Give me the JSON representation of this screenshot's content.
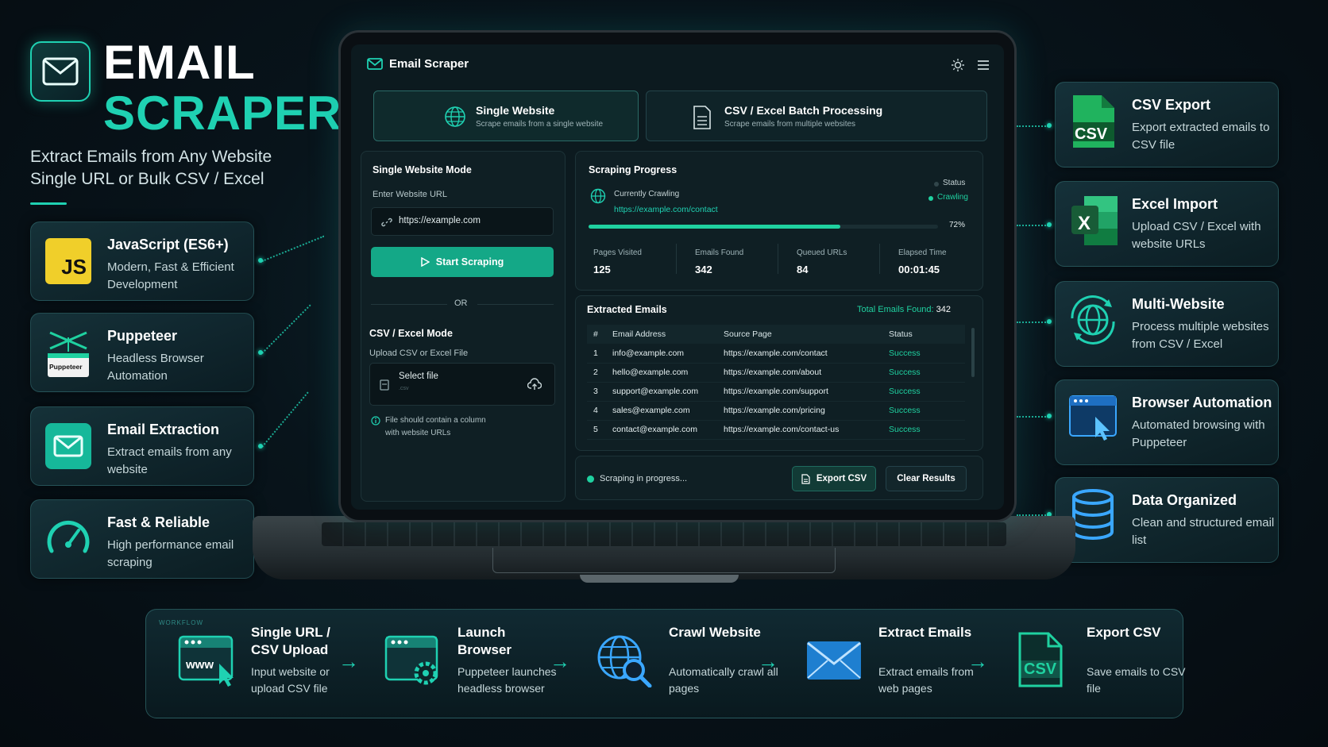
{
  "brand": {
    "title_line1": "EMAIL",
    "title_line2": "SCRAPER",
    "tagline_line1": "Extract Emails from Any Website",
    "tagline_line2": "Single URL or Bulk CSV / Excel",
    "accent_color": "#1fd1b2"
  },
  "left_features": [
    {
      "icon": "js-icon",
      "title": "JavaScript (ES6+)",
      "desc": "Modern, Fast & Efficient Development",
      "badge": "JS"
    },
    {
      "icon": "puppeteer-icon",
      "title": "Puppeteer",
      "desc": "Headless Browser Automation",
      "badge": "Puppeteer"
    },
    {
      "icon": "envelope-icon",
      "title": "Email Extraction",
      "desc": "Extract emails from any website"
    },
    {
      "icon": "speedometer-icon",
      "title": "Fast & Reliable",
      "desc": "High performance email scraping"
    }
  ],
  "right_features": [
    {
      "icon": "csv-file-icon",
      "title": "CSV Export",
      "desc": "Export extracted emails to CSV file",
      "badge": "CSV"
    },
    {
      "icon": "excel-icon",
      "title": "Excel Import",
      "desc": "Upload CSV / Excel with website URLs",
      "badge": "X"
    },
    {
      "icon": "globe-sync-icon",
      "title": "Multi-Website",
      "desc": "Process multiple websites from CSV / Excel"
    },
    {
      "icon": "browser-cursor-icon",
      "title": "Browser Automation",
      "desc": "Automated browsing with Puppeteer"
    },
    {
      "icon": "database-icon",
      "title": "Data Organized",
      "desc": "Clean and structured email list"
    }
  ],
  "app": {
    "title": "Email Scraper",
    "tabs": [
      {
        "title": "Single Website",
        "subtitle": "Scrape emails from a single website",
        "active": true
      },
      {
        "title": "CSV / Excel Batch Processing",
        "subtitle": "Scrape emails from multiple websites",
        "active": false
      }
    ],
    "single_mode": {
      "heading": "Single Website Mode",
      "url_label": "Enter Website URL",
      "url_value": "https://example.com",
      "start_button": "Start Scraping",
      "or_label": "OR"
    },
    "csv_mode": {
      "heading": "CSV / Excel Mode",
      "upload_label": "Upload CSV or Excel File",
      "select_file": "Select file",
      "file_hint": ".csv",
      "info_line1": "File should contain a column",
      "info_line2": "with website URLs"
    },
    "progress": {
      "heading": "Scraping Progress",
      "status_label": "Status",
      "status_value": "Crawling",
      "crawling_label": "Currently Crawling",
      "crawling_url": "https://example.com/contact",
      "percent": 72,
      "percent_label": "72%",
      "stats": [
        {
          "label": "Pages Visited",
          "value": "125"
        },
        {
          "label": "Emails Found",
          "value": "342"
        },
        {
          "label": "Queued URLs",
          "value": "84"
        },
        {
          "label": "Elapsed Time",
          "value": "00:01:45"
        }
      ]
    },
    "extracted": {
      "heading": "Extracted Emails",
      "total_label": "Total Emails Found:",
      "total_value": "342",
      "columns": [
        "#",
        "Email Address",
        "Source Page",
        "Status"
      ],
      "rows": [
        [
          "1",
          "info@example.com",
          "https://example.com/contact",
          "Success"
        ],
        [
          "2",
          "hello@example.com",
          "https://example.com/about",
          "Success"
        ],
        [
          "3",
          "support@example.com",
          "https://example.com/support",
          "Success"
        ],
        [
          "4",
          "sales@example.com",
          "https://example.com/pricing",
          "Success"
        ],
        [
          "5",
          "contact@example.com",
          "https://example.com/contact-us",
          "Success"
        ]
      ]
    },
    "footer": {
      "status": "Scraping in progress...",
      "export_button": "Export CSV",
      "clear_button": "Clear Results"
    }
  },
  "workflow": {
    "watermark": "WORKFLOW",
    "steps": [
      {
        "icon": "browser-www-icon",
        "title": "Single URL / CSV Upload",
        "desc": "Input website or upload CSV file"
      },
      {
        "icon": "browser-gear-icon",
        "title": "Launch Browser",
        "desc": "Puppeteer launches headless browser"
      },
      {
        "icon": "globe-search-icon",
        "title": "Crawl Website",
        "desc": "Automatically crawl all pages"
      },
      {
        "icon": "envelope-icon",
        "title": "Extract Emails",
        "desc": "Extract emails from web pages"
      },
      {
        "icon": "csv-file-icon",
        "title": "Export CSV",
        "desc": "Save emails to CSV file",
        "badge": "CSV"
      }
    ]
  }
}
